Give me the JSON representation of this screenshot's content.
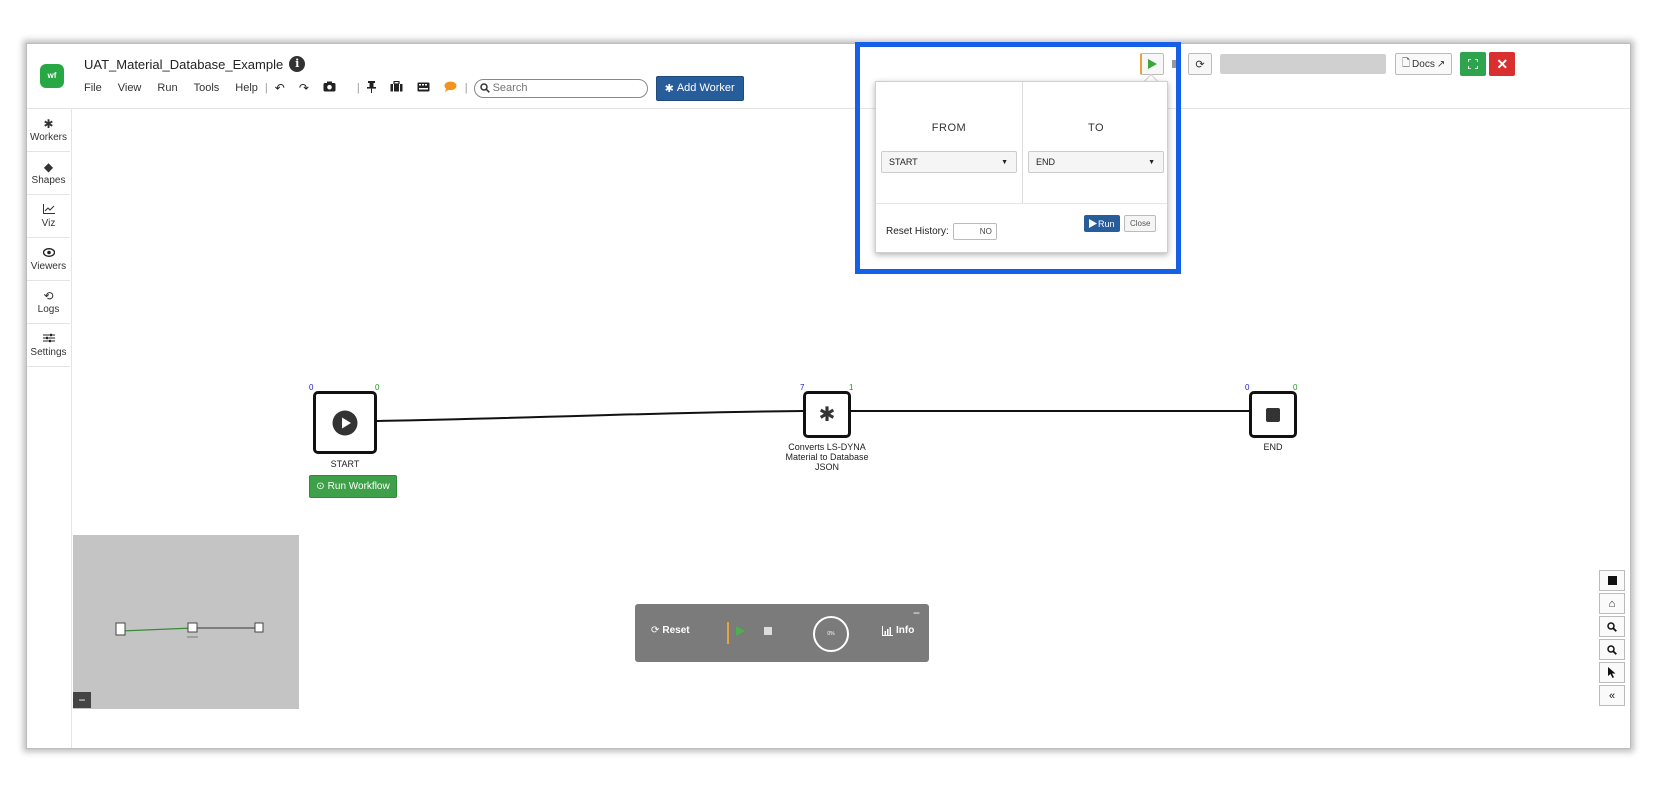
{
  "app": {
    "title": "UAT_Material_Database_Example",
    "info_glyph": "i",
    "logo_text": "wf"
  },
  "menu": [
    "File",
    "View",
    "Run",
    "Tools",
    "Help"
  ],
  "search": {
    "placeholder": "Search"
  },
  "toolbar": {
    "add_worker_label": "Add Worker"
  },
  "top_right": {
    "docs_label": "Docs"
  },
  "sidebar": {
    "items": [
      {
        "label": "Workers",
        "icon": "gear-icon"
      },
      {
        "label": "Shapes",
        "icon": "diamond-icon"
      },
      {
        "label": "Viz",
        "icon": "line-chart-icon"
      },
      {
        "label": "Viewers",
        "icon": "eye-icon"
      },
      {
        "label": "Logs",
        "icon": "history-icon"
      },
      {
        "label": "Settings",
        "icon": "sliders-icon"
      }
    ]
  },
  "workflow": {
    "nodes": [
      {
        "label": "START",
        "port_in": "0",
        "port_out": "0",
        "icon": "play-circle-icon"
      },
      {
        "label": "Converts LS-DYNA Material to Database JSON",
        "label_lines": [
          "Converts LS-DYNA",
          "Material to Database",
          "JSON"
        ],
        "port_in": "7",
        "port_out": "1",
        "icon": "gear-icon"
      },
      {
        "label": "END",
        "port_in": "0",
        "port_out": "0",
        "icon": "stop-icon"
      }
    ],
    "run_workflow_label": "Run Workflow"
  },
  "run_panel": {
    "reset_label": "Reset",
    "info_label": "Info",
    "progress_text": "0%",
    "progress_value": 0
  },
  "run_popup": {
    "from_header": "FROM",
    "to_header": "TO",
    "from_value": "START",
    "to_value": "END",
    "reset_history_label": "Reset History:",
    "reset_history_value": "NO",
    "run_label": "Run",
    "close_label": "Close"
  },
  "colors": {
    "primary_blue": "#285d9c",
    "success_green": "#3ea14a",
    "danger_red": "#d9302f",
    "highlight": "#1660e8",
    "port_in": "#1a1acc",
    "port_out": "#1c9a1c"
  }
}
